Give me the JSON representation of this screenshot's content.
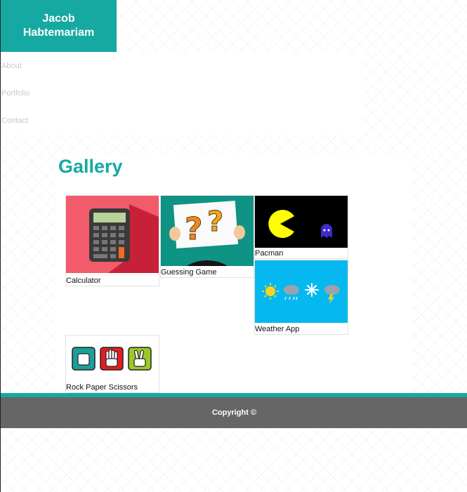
{
  "header": {
    "name_line1": "Jacob",
    "name_line2": "Habtemariam"
  },
  "nav": {
    "items": [
      "About",
      "Portfolio",
      "Contact"
    ]
  },
  "gallery": {
    "title": "Gallery",
    "projects": [
      {
        "caption": "Calculator",
        "thumb": "calculator-thumbnail"
      },
      {
        "caption": "Guessing Game",
        "thumb": "question-marks-sign-thumbnail"
      },
      {
        "caption": "Pacman",
        "thumb": "pacman-ghost-thumbnail"
      },
      {
        "caption": "Weather App",
        "thumb": "weather-icons-thumbnail"
      },
      {
        "caption": "Rock Paper Scissors",
        "thumb": "hand-signs-thumbnail"
      }
    ]
  },
  "footer": {
    "copyright": "Copyright ©"
  },
  "colors": {
    "accent": "#16a9a2",
    "footer_bg": "#666666",
    "title": "#16a9a2"
  }
}
